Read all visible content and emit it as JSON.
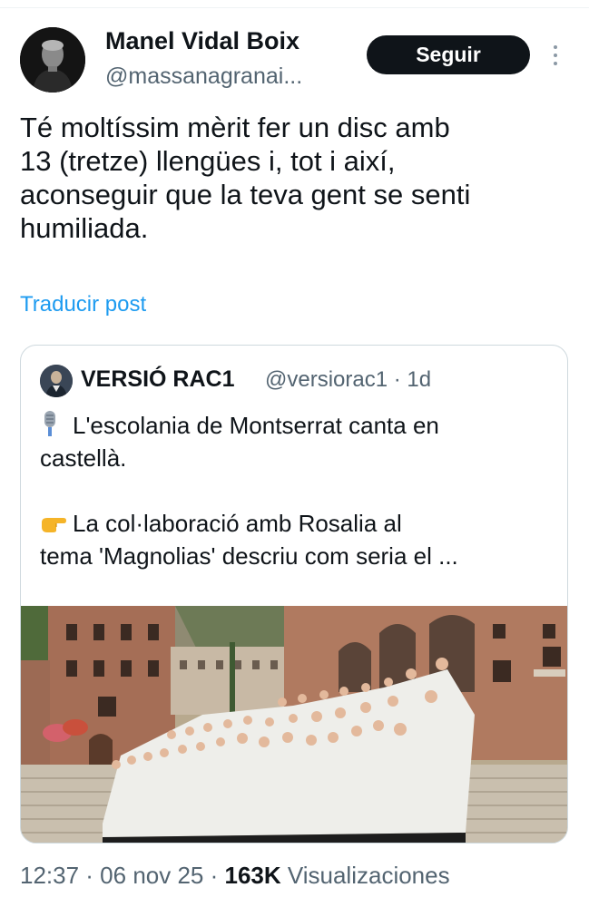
{
  "tweet": {
    "author_name": "Manel Vidal Boix",
    "author_handle": "@massanagranai...",
    "follow_label": "Seguir",
    "text_lines": [
      "Té moltíssim mèrit fer un disc amb",
      "13 (tretze) llengües i, tot i així,",
      "aconseguir que la teva gent se senti",
      "humiliada."
    ],
    "translate_label": "Traducir post"
  },
  "quote": {
    "author_name": "VERSIÓ RAC1",
    "author_handle": "@versiorac1 · 1d",
    "line1_emoji": "microphone-emoji",
    "line1": "L'escolania de Montserrat canta en",
    "line2": "castellà.",
    "line3_emoji": "pointing-hand-emoji",
    "line3": "La col·laboració amb Rosalia al",
    "line4": "tema 'Magnolias' descriu com seria el ..."
  },
  "meta": {
    "time": "12:37 · 06 nov 25 · ",
    "views_count": "163K",
    "views_label": " Visualizaciones"
  },
  "colors": {
    "accent": "#1d9bf0",
    "text": "#0f1419",
    "muted": "#536471",
    "button_bg": "#0f1419"
  }
}
